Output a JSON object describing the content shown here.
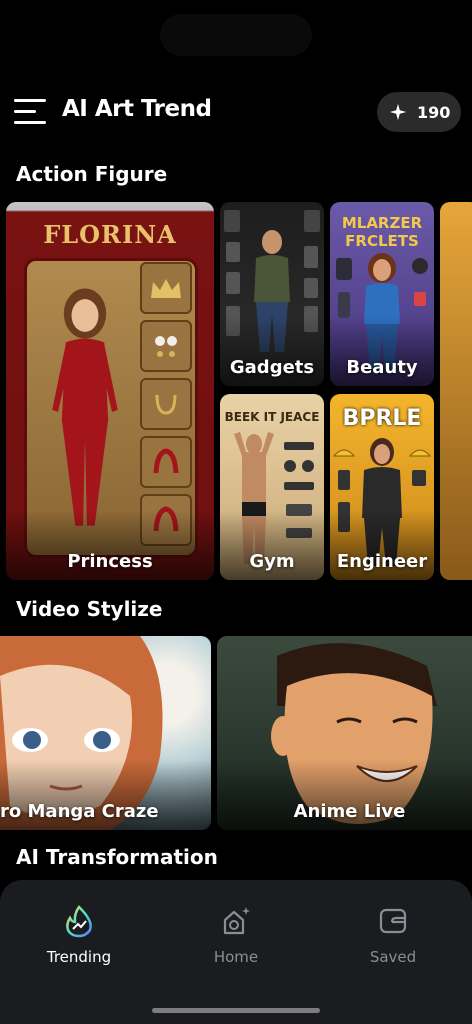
{
  "header": {
    "title": "AI Art Trend",
    "credits": "190"
  },
  "sections": {
    "action_figure": "Action Figure",
    "video_stylize": "Video Stylize",
    "ai_transformation": "AI Transformation"
  },
  "action_figure_tiles": [
    {
      "label": "Princess",
      "package_text": "FLORINA"
    },
    {
      "label": "Gadgets"
    },
    {
      "label": "Beauty",
      "package_text": "MLARZER FRCLETS"
    },
    {
      "label": "Gym",
      "package_text": "BEEK IT JEACE"
    },
    {
      "label": "Engineer",
      "package_text": "BPRLE"
    }
  ],
  "video_tiles": [
    {
      "label": "ro Manga Craze"
    },
    {
      "label": "Anime Live"
    }
  ],
  "nav": {
    "items": [
      {
        "label": "Trending",
        "icon": "trending-icon",
        "active": true
      },
      {
        "label": "Home",
        "icon": "home-sparkle-icon",
        "active": false
      },
      {
        "label": "Saved",
        "icon": "saved-icon",
        "active": false
      }
    ]
  },
  "colors": {
    "background": "#000000",
    "nav_background": "#1a1c20",
    "active_nav": "#ffffff",
    "inactive_nav": "#8a8d93",
    "credits_pill": "#2b2b2b"
  }
}
